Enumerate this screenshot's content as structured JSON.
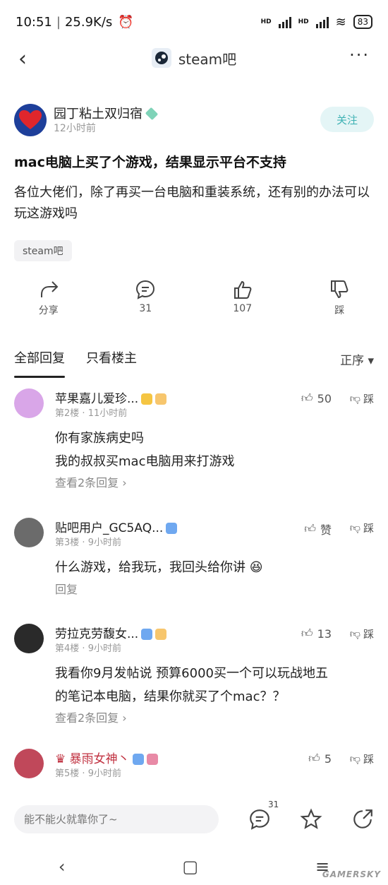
{
  "status": {
    "time": "10:51",
    "speed": "25.9K/s",
    "signal1": "HD",
    "signal2": "HD",
    "battery": "83"
  },
  "header": {
    "forum_name": "steam吧",
    "back_icon": "back-chevron-icon",
    "more_icon": "more-dots-icon"
  },
  "post": {
    "author": "园丁粘土双归宿",
    "time": "12小时前",
    "follow_label": "关注",
    "title": "mac电脑上买了个游戏，结果显示平台不支持",
    "body": "各位大佬们，除了再买一台电脑和重装系统，还有别的办法可以玩这游戏吗",
    "tag": "steam吧",
    "actions": [
      {
        "label": "分享",
        "icon": "share-icon"
      },
      {
        "label": "31",
        "icon": "comment-icon"
      },
      {
        "label": "107",
        "icon": "thumb-up-icon"
      },
      {
        "label": "踩",
        "icon": "thumb-down-icon"
      }
    ]
  },
  "tabs": {
    "all": "全部回复",
    "op_only": "只看楼主",
    "sort": "正序"
  },
  "comments": [
    {
      "name": "苹果嘉儿爱珍...",
      "floor": "第2楼",
      "time": "11小时前",
      "text1": "你有家族病史吗",
      "text2": "我的叔叔买mac电脑用来打游戏",
      "sub": "查看2条回复 ›",
      "likes": "50",
      "dislike": "踩",
      "avatar_color": "#d9a6e8"
    },
    {
      "name": "贴吧用户_GC5AQ...",
      "floor": "第3楼",
      "time": "9小时前",
      "text1": "什么游戏，给我玩，我回头给你讲",
      "sub": "回复",
      "likes": "赞",
      "dislike": "踩",
      "avatar_color": "#6b6b6b"
    },
    {
      "name": "劳拉克劳馥女...",
      "floor": "第4楼",
      "time": "9小时前",
      "text1": "我看你9月发帖说 预算6000买一个可以玩战地五",
      "text2": "的笔记本电脑，结果你就买了个mac？？",
      "sub": "查看2条回复 ›",
      "likes": "13",
      "dislike": "踩",
      "avatar_color": "#2a2a2a"
    },
    {
      "name": "暴雨女神丶",
      "floor": "第5楼",
      "time": "9小时前",
      "likes": "5",
      "dislike": "踩",
      "avatar_color": "#c0485a"
    }
  ],
  "inputbar": {
    "placeholder": "能不能火就靠你了~",
    "comment_count": "31"
  },
  "watermark": "GAMERSKY"
}
